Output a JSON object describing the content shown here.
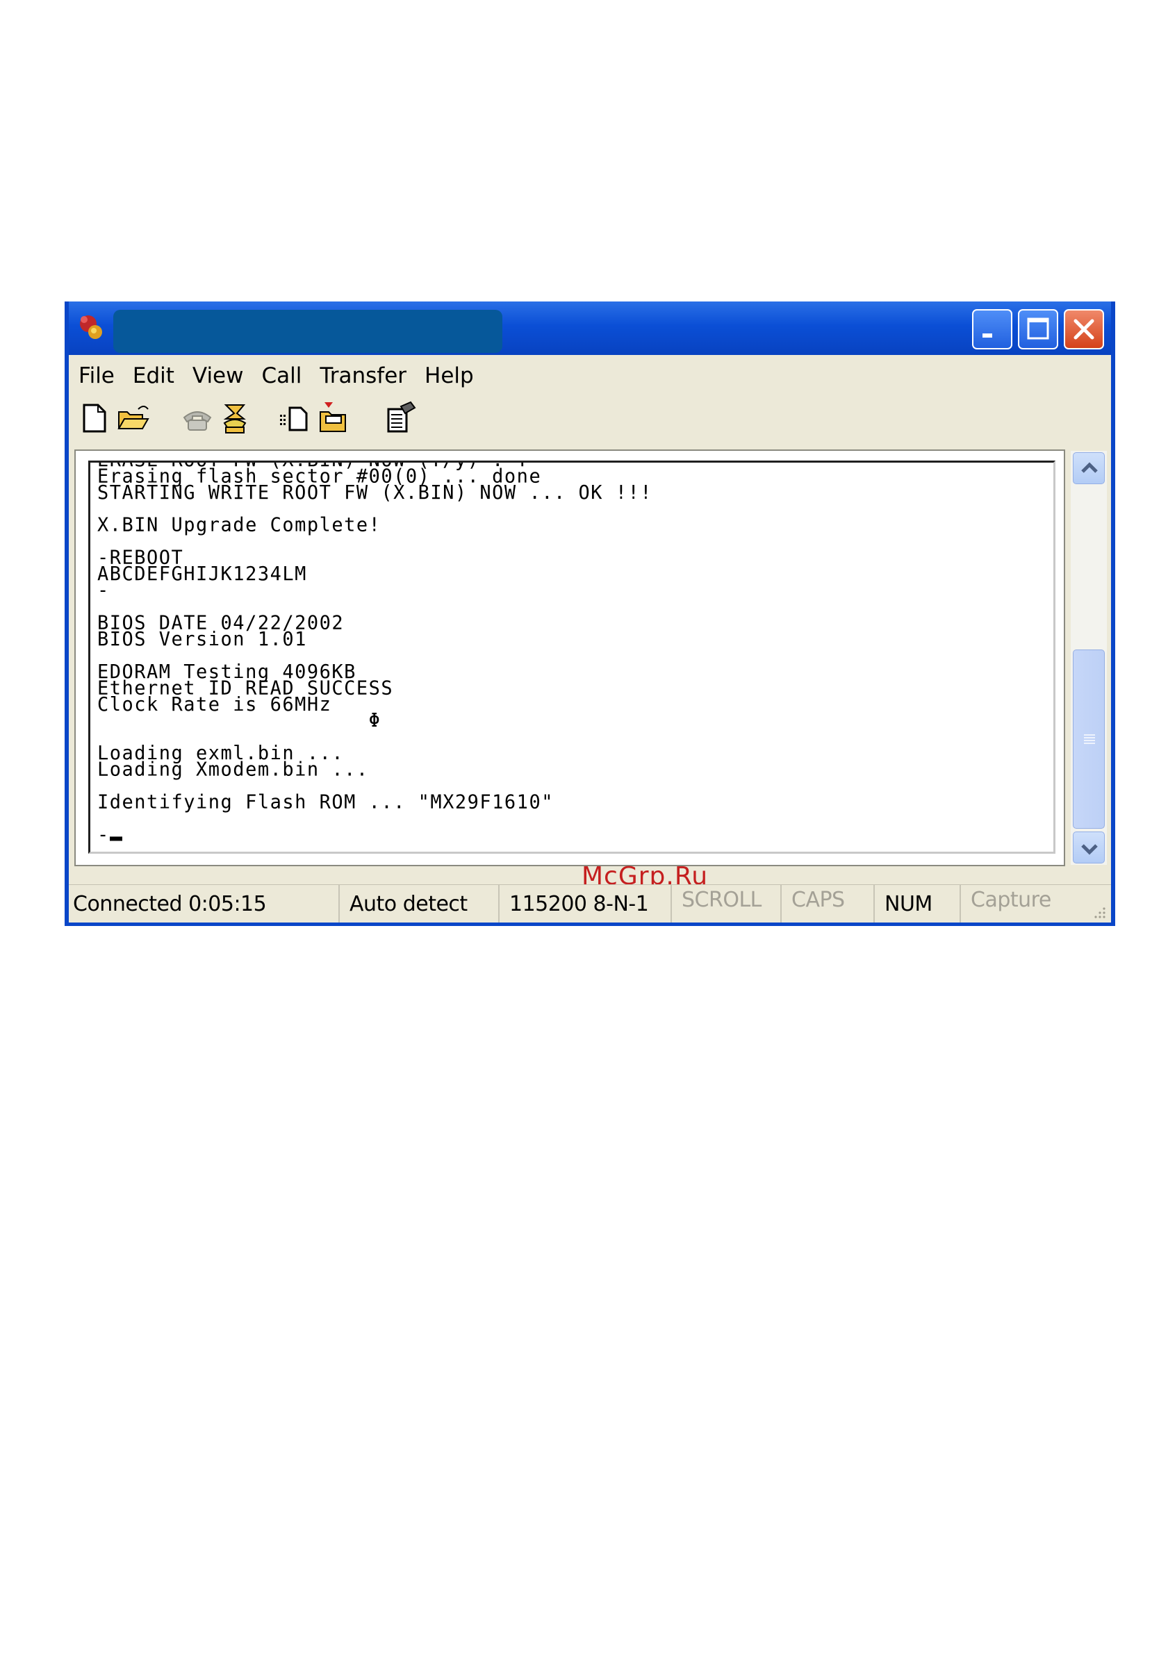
{
  "window": {
    "title": "",
    "controls": {
      "minimize": "minimize-icon",
      "maximize": "maximize-icon",
      "close": "close-icon"
    }
  },
  "menu": [
    "File",
    "Edit",
    "View",
    "Call",
    "Transfer",
    "Help"
  ],
  "toolbar": [
    "new-icon",
    "open-icon",
    "disconnect-icon",
    "dial-icon",
    "send-icon",
    "receive-icon",
    "properties-icon"
  ],
  "terminal": {
    "lines": [
      "ERASE ROOT FW (X.BIN) NOW (Y/y) : Y",
      "Erasing flash sector #00(0) ... done",
      "STARTING WRITE ROOT FW (X.BIN) NOW ... OK !!!",
      "",
      "X.BIN Upgrade Complete!",
      "",
      "-REBOOT",
      "ABCDEFGHIJK1234LM",
      "-",
      "",
      "BIOS DATE 04/22/2002",
      "BIOS Version 1.01",
      "",
      "EDORAM Testing 4096KB",
      "Ethernet ID READ SUCCESS",
      "Clock Rate is 66MHz",
      "                      Φ",
      "",
      "Loading exml.bin ...",
      "Loading Xmodem.bin ...",
      "",
      "Identifying Flash ROM ... \"MX29F1610\"",
      "",
      "-"
    ]
  },
  "watermark": "McGrp.Ru",
  "status": {
    "connection": "Connected 0:05:15",
    "detect": "Auto detect",
    "settings": "115200 8-N-1",
    "scroll": "SCROLL",
    "caps": "CAPS",
    "num": "NUM",
    "capture": "Capture"
  }
}
